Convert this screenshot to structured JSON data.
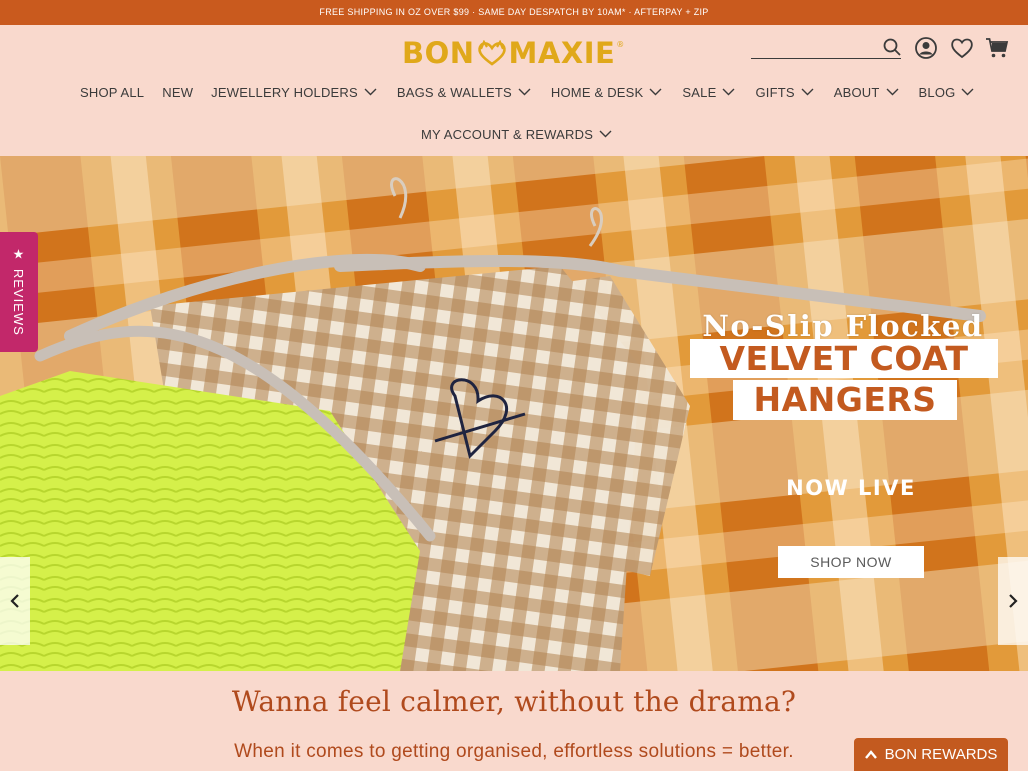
{
  "announcement": "FREE SHIPPING IN OZ OVER $99 · SAME DAY DESPATCH BY 10AM* · AFTERPAY + ZIP",
  "brand": {
    "left": "BON",
    "right": "MAXIE",
    "reg": "®"
  },
  "search": {
    "placeholder": "",
    "value": ""
  },
  "nav": {
    "row1": [
      {
        "label": "SHOP ALL",
        "dropdown": false
      },
      {
        "label": "NEW",
        "dropdown": false
      },
      {
        "label": "JEWELLERY HOLDERS",
        "dropdown": true
      },
      {
        "label": "BAGS & WALLETS",
        "dropdown": true
      },
      {
        "label": "HOME & DESK",
        "dropdown": true
      },
      {
        "label": "SALE",
        "dropdown": true
      },
      {
        "label": "GIFTS",
        "dropdown": true
      },
      {
        "label": "ABOUT",
        "dropdown": true
      },
      {
        "label": "BLOG",
        "dropdown": true
      }
    ],
    "row2": [
      {
        "label": "MY ACCOUNT & REWARDS",
        "dropdown": true
      }
    ]
  },
  "hero": {
    "title_line1": "No-Slip Flocked",
    "title_line2": "VELVET COAT",
    "title_line3": "HANGERS",
    "status": "NOW LIVE",
    "cta": "SHOP NOW"
  },
  "reviews_tab": {
    "label": "REVIEWS",
    "icon": "star-icon"
  },
  "tagline": "Wanna feel calmer, without the drama?",
  "subline": "When it comes to getting organised, effortless solutions = better.",
  "rewards_button": "BON REWARDS",
  "colors": {
    "announcement_bg": "#c95a1e",
    "page_bg": "#f9d9cd",
    "brand_gold": "#e0a81a",
    "accent_orange": "#c35a1f",
    "reviews_pink": "#c2286a"
  }
}
